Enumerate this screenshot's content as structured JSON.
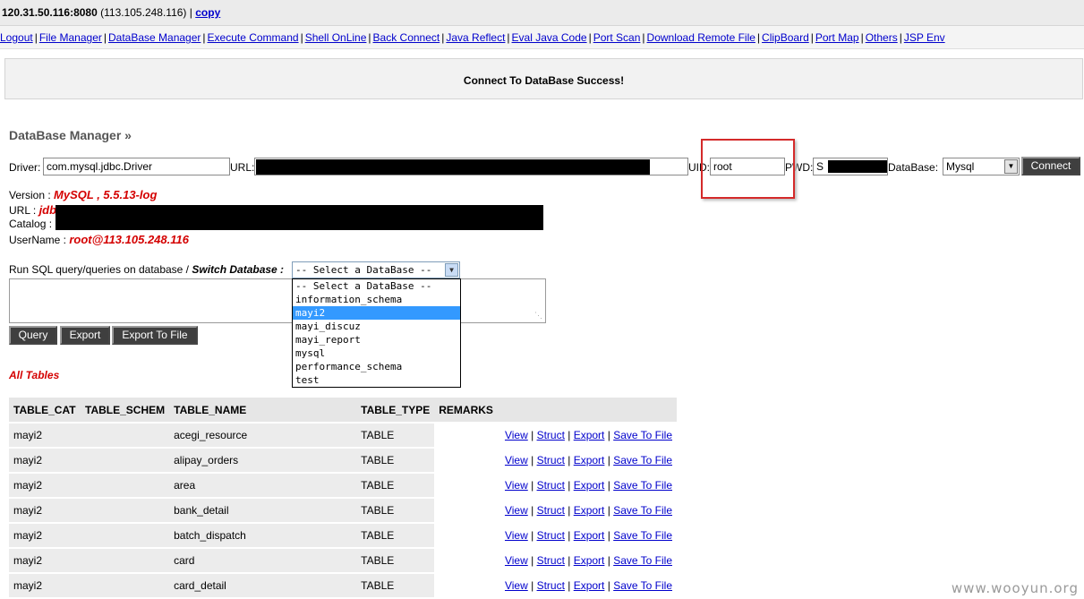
{
  "header": {
    "host": "120.31.50.116:8080",
    "ip": "(113.105.248.116)",
    "copy_label": "copy"
  },
  "nav": [
    "Logout",
    "File Manager",
    "DataBase Manager",
    "Execute Command",
    "Shell OnLine",
    "Back Connect",
    "Java Reflect",
    "Eval Java Code",
    "Port Scan",
    "Download Remote File",
    "ClipBoard",
    "Port Map",
    "Others",
    "JSP Env"
  ],
  "message": "Connect To DataBase Success!",
  "db_manager": {
    "title": "DataBase Manager »",
    "driver_label": "Driver:",
    "driver_value": "com.mysql.jdbc.Driver",
    "url_label": "URL:",
    "uid_label": "UID:",
    "uid_value": "root",
    "pwd_label": "PWD:",
    "pwd_value": "S",
    "database_label": "DataBase:",
    "database_value": "Mysql",
    "connect_label": "Connect"
  },
  "info": {
    "version_label": "Version : ",
    "version_value": "MySQL , 5.5.13-log",
    "url_label": "URL : ",
    "url_value": "jdb",
    "catalog_label": "Catalog : ",
    "username_label": "UserName : ",
    "username_value": "root@113.105.248.116"
  },
  "sql": {
    "prompt_label": "Run SQL query/queries on database / ",
    "switch_label": "Switch Database :",
    "selected": "-- Select a DataBase --",
    "options": [
      "-- Select a DataBase --",
      "information_schema",
      "mayi2",
      "mayi_discuz",
      "mayi_report",
      "mysql",
      "performance_schema",
      "test"
    ],
    "highlighted": "mayi2",
    "query_label": "Query",
    "export_label": "Export",
    "export_file_label": "Export To File"
  },
  "tables": {
    "title": "All Tables",
    "columns": [
      "TABLE_CAT",
      "TABLE_SCHEM",
      "TABLE_NAME",
      "TABLE_TYPE",
      "REMARKS"
    ],
    "rows": [
      {
        "cat": "mayi2",
        "schem": "",
        "name": "acegi_resource",
        "type": "TABLE"
      },
      {
        "cat": "mayi2",
        "schem": "",
        "name": "alipay_orders",
        "type": "TABLE"
      },
      {
        "cat": "mayi2",
        "schem": "",
        "name": "area",
        "type": "TABLE"
      },
      {
        "cat": "mayi2",
        "schem": "",
        "name": "bank_detail",
        "type": "TABLE"
      },
      {
        "cat": "mayi2",
        "schem": "",
        "name": "batch_dispatch",
        "type": "TABLE"
      },
      {
        "cat": "mayi2",
        "schem": "",
        "name": "card",
        "type": "TABLE"
      },
      {
        "cat": "mayi2",
        "schem": "",
        "name": "card_detail",
        "type": "TABLE"
      }
    ],
    "actions": [
      "View",
      "Struct",
      "Export",
      "Save To File"
    ]
  },
  "watermark": "www.wooyun.org"
}
